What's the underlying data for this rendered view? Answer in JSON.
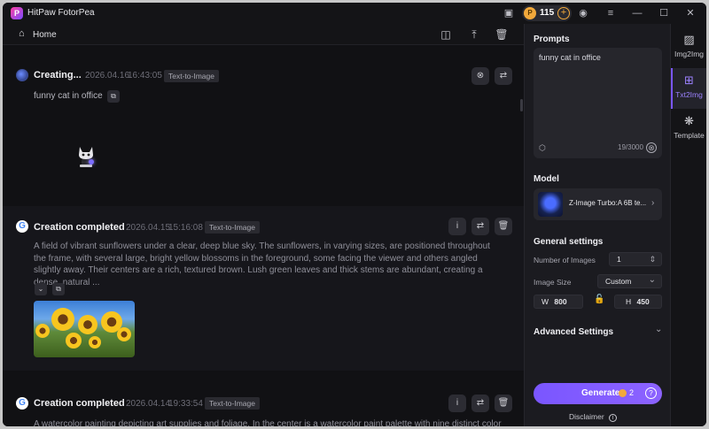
{
  "titlebar": {
    "app_name": "HitPaw FotorPea",
    "logo_letter": "P",
    "credits": "115",
    "coin_symbol": "P",
    "icons": [
      "feedback-icon",
      "add-credits-icon",
      "account-icon",
      "menu-icon",
      "minimize-icon",
      "maximize-icon",
      "close-icon"
    ],
    "glyphs": {
      "feedback": "▣",
      "plus": "+",
      "account": "◉",
      "menu": "≡",
      "minimize": "—",
      "maximize": "☐",
      "close": "✕"
    }
  },
  "toolbar": {
    "home_label": "Home",
    "home_glyph": "⌂",
    "glyphs": {
      "compare": "◫",
      "upload": "⤒",
      "delete": "🗑"
    }
  },
  "feed": {
    "items": [
      {
        "status": "Creating...",
        "date": "2026.04.16",
        "time": "16:43:05",
        "type": "Text-to-Image",
        "prompt": "funny cat in office",
        "copy_glyph": "⧉",
        "cancel_glyph": "⊗",
        "regen_glyph": "⇄"
      },
      {
        "status": "Creation completed",
        "date": "2026.04.15",
        "time": "15:16:08",
        "type": "Text-to-Image",
        "avatar_letter": "G",
        "description": "A field of vibrant sunflowers under a clear, deep blue sky. The sunflowers, in varying sizes, are positioned throughout the frame, with several large, bright yellow blossoms in the foreground, some facing the viewer and others angled slightly away. Their centers are a rich, textured brown. Lush green leaves and thick stems are abundant, creating a dense, natural ...",
        "info_glyph": "i",
        "regen_glyph": "⇄",
        "delete_glyph": "🗑",
        "expand_glyph": "⌄",
        "copy_glyph": "⧉"
      },
      {
        "status": "Creation completed",
        "date": "2026.04.14",
        "time": "19:33:54",
        "type": "Text-to-Image",
        "avatar_letter": "G",
        "description": "A watercolor painting depicting art supplies and foliage. In the center is a watercolor paint palette with nine distinct color",
        "info_glyph": "i",
        "regen_glyph": "⇄",
        "delete_glyph": "🗑"
      }
    ]
  },
  "panel": {
    "prompts_title": "Prompts",
    "prompt_value": "funny cat in office",
    "char_count": "19/3000",
    "model_title": "Model",
    "model_name": "Z-Image Turbo:A 6B te...",
    "general_title": "General settings",
    "num_images_label": "Number of Images",
    "num_images_value": "1",
    "image_size_label": "Image Size",
    "image_size_value": "Custom",
    "width_label": "W",
    "width_value": "800",
    "height_label": "H",
    "height_value": "450",
    "advanced_title": "Advanced Settings",
    "generate_label": "Generate",
    "generate_cost": "2",
    "disclaimer": "Disclaimer",
    "glyphs": {
      "chevron_right": "›",
      "chevron_down": "⌄",
      "stepper": "⇕",
      "lock": "🔓",
      "help": "?",
      "info": "i",
      "cube": "⬡",
      "clear": "⊗"
    }
  },
  "rail": {
    "items": [
      {
        "label": "Img2Img",
        "glyph": "▨",
        "active": false
      },
      {
        "label": "Txt2Img",
        "glyph": "⊞",
        "active": true
      },
      {
        "label": "Template",
        "glyph": "❋",
        "active": false
      }
    ]
  },
  "colors": {
    "accent": "#7a56ff",
    "coin": "#f2a93b",
    "bg": "#111114",
    "panel": "#1b1b20"
  }
}
